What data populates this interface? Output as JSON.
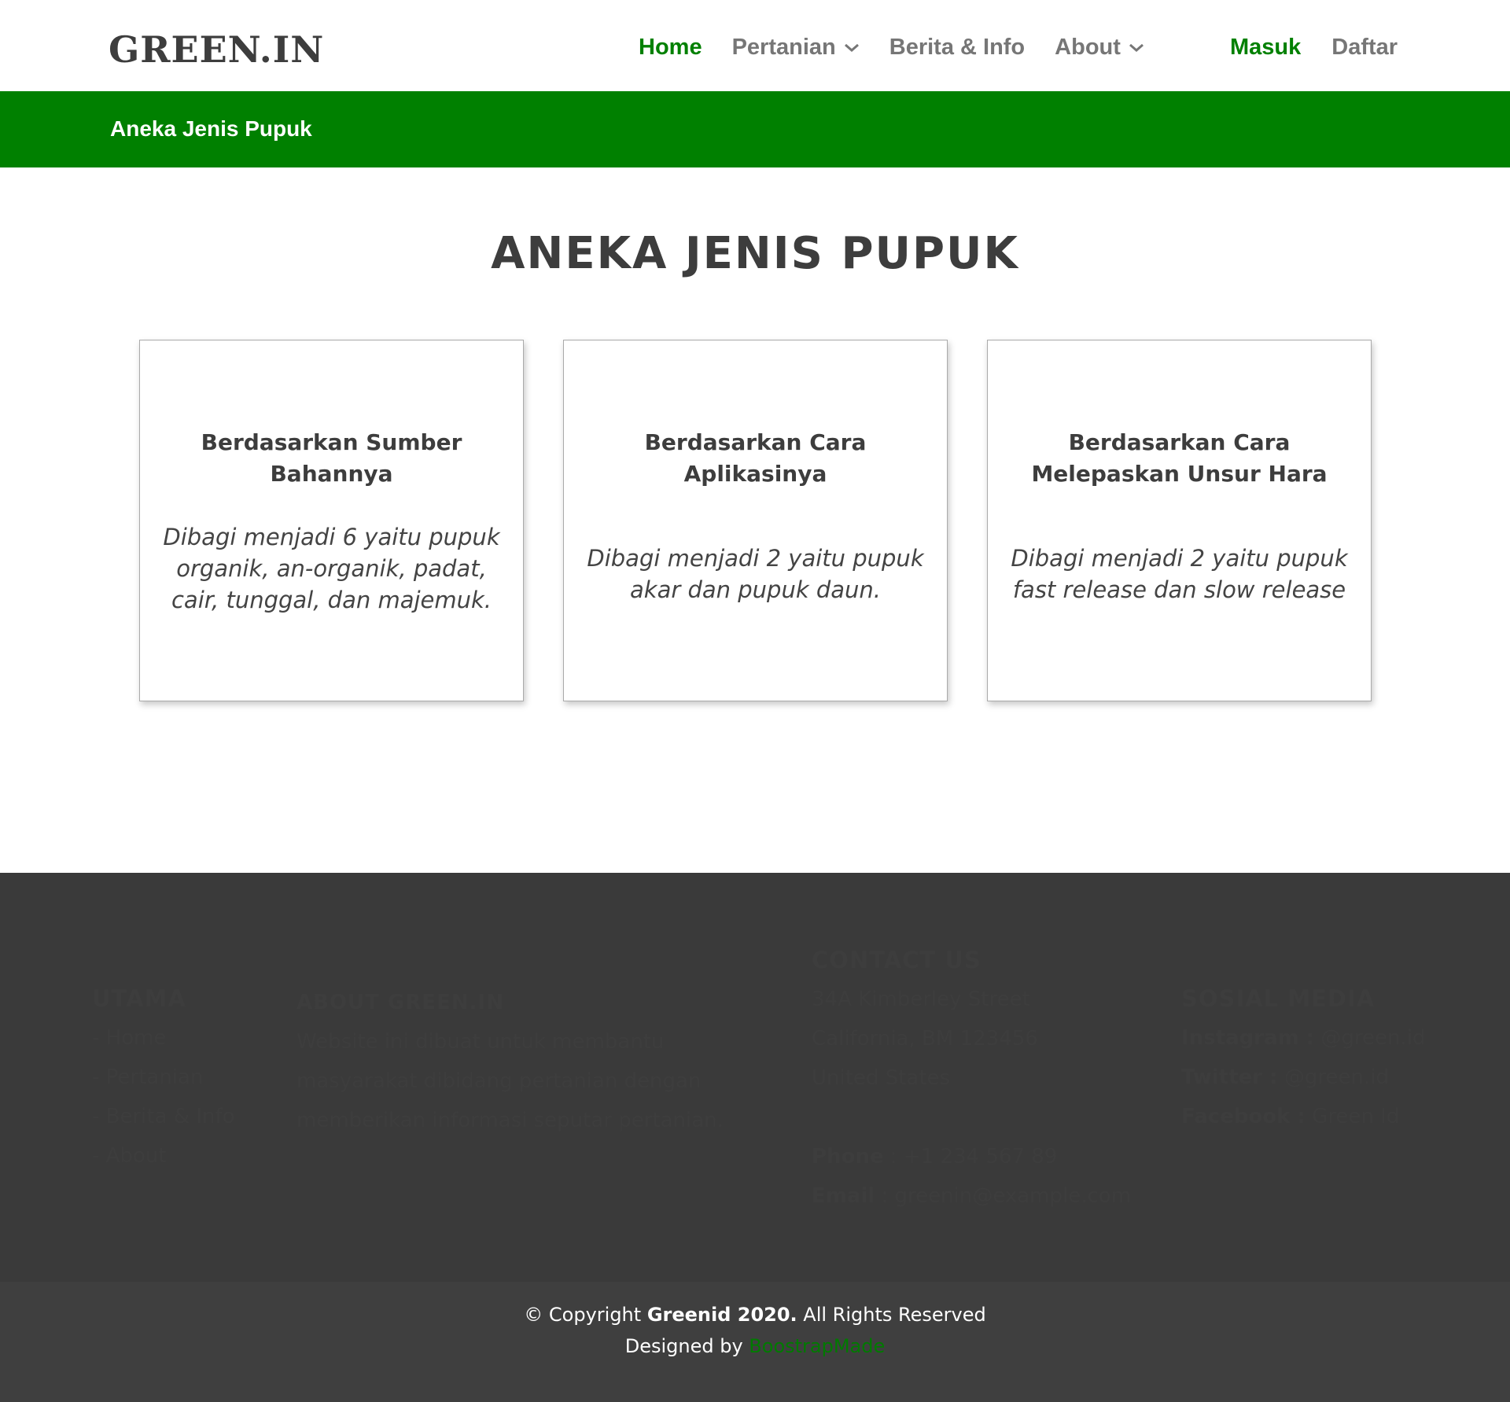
{
  "header": {
    "logo": "GREEN.IN",
    "nav": [
      {
        "label": "Home",
        "active": true,
        "dropdown": false
      },
      {
        "label": "Pertanian",
        "active": false,
        "dropdown": true
      },
      {
        "label": "Berita & Info",
        "active": false,
        "dropdown": false
      },
      {
        "label": "About",
        "active": false,
        "dropdown": true
      }
    ],
    "login": "Masuk",
    "register": "Daftar"
  },
  "breadcrumb": "Aneka Jenis Pupuk",
  "main": {
    "title": "ANEKA JENIS PUPUK",
    "cards": [
      {
        "title": "Berdasarkan Sumber Bahannya",
        "text": "Dibagi menjadi 6 yaitu pupuk organik, an-organik, padat, cair, tunggal, dan majemuk."
      },
      {
        "title": "Berdasarkan Cara Aplikasinya",
        "text": "Dibagi menjadi 2 yaitu pupuk akar dan pupuk daun."
      },
      {
        "title": "Berdasarkan Cara Melepaskan Unsur Hara",
        "text": "Dibagi menjadi 2 yaitu pupuk fast release dan slow release"
      }
    ]
  },
  "footer": {
    "utama": {
      "heading": "UTAMA",
      "links": [
        "- Home",
        "- Pertanian",
        "- Berita & Info",
        "- About"
      ]
    },
    "about": {
      "heading": "ABOUT GREEN.IN",
      "lines": [
        "Website ini dibuat untuk membantu",
        "masyarakat dibidang pertanian dengan",
        "memberikan informasi seputar pertanian."
      ]
    },
    "contact": {
      "heading": "CONTACT US",
      "address": [
        "34A Kimberley Street",
        "California, BM 123456",
        "United States"
      ],
      "phone_label": "Phone",
      "phone": " : +1 234 567 89",
      "email_label": "Email",
      "email": " : greenin@example.com"
    },
    "sosial": {
      "heading": "SOSIAL MEDIA",
      "items": [
        {
          "label": "Instagram :",
          "value": " @green.id"
        },
        {
          "label": "Twitter :",
          "value": " @green.id"
        },
        {
          "label": "Facebook :",
          "value": " Green Id"
        }
      ]
    }
  },
  "copyright": {
    "prefix": "© Copyright ",
    "brand": "Greenid 2020.",
    "suffix": " All Rights Reserved",
    "designed_by": "Designed by ",
    "designer": "BoostrapMade"
  },
  "colors": {
    "accent": "#008000",
    "footer_bg": "#3a3a3a",
    "text": "#3d3d3d",
    "nav_inactive": "#767676"
  }
}
